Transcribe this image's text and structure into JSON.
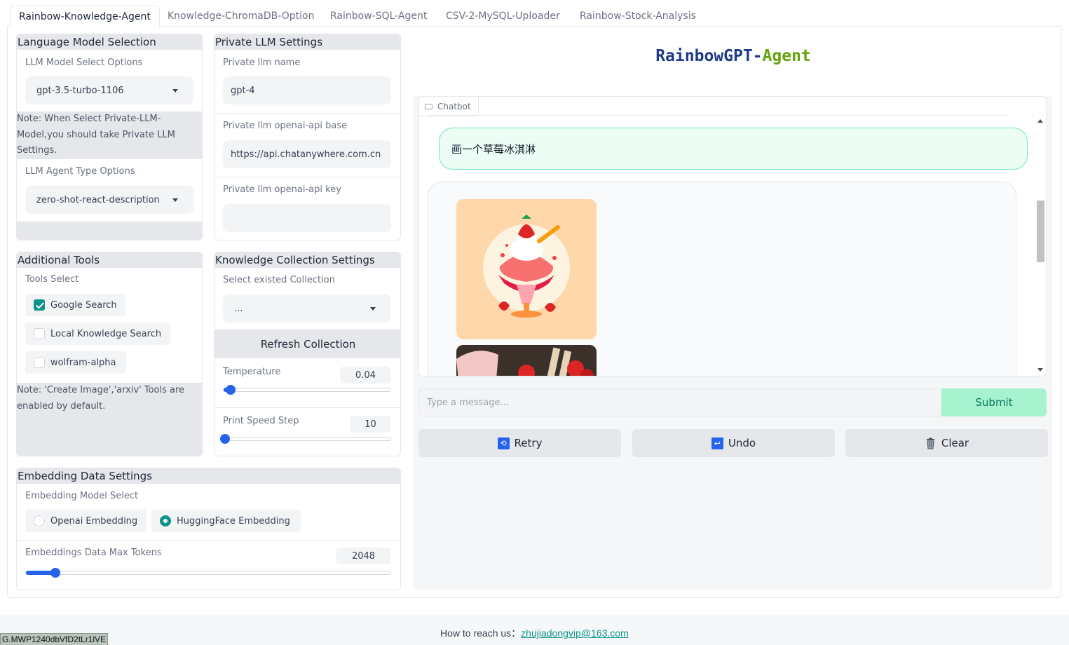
{
  "tabs": [
    {
      "label": "Rainbow-Knowledge-Agent",
      "active": true
    },
    {
      "label": "Knowledge-ChromaDB-Option"
    },
    {
      "label": "Rainbow-SQL-Agent"
    },
    {
      "label": "CSV-2-MySQL-Uploader"
    },
    {
      "label": "Rainbow-Stock-Analysis"
    }
  ],
  "llm_selection": {
    "title": "Language Model Selection",
    "model_label": "LLM Model Select Options",
    "model_value": "gpt-3.5-turbo-1106",
    "note": "Note: When Select Private-LLM-Model,you should take Private LLM Settings.",
    "agent_label": "LLM Agent Type Options",
    "agent_value": "zero-shot-react-description"
  },
  "private_llm": {
    "title": "Private LLM Settings",
    "name_label": "Private llm name",
    "name_value": "gpt-4",
    "base_label": "Private llm openai-api base",
    "base_value": "https://api.chatanywhere.com.cn",
    "key_label": "Private llm openai-api key",
    "key_value": ""
  },
  "tools": {
    "title": "Additional Tools",
    "label": "Tools Select",
    "options": [
      {
        "label": "Google Search",
        "checked": true
      },
      {
        "label": "Local Knowledge Search",
        "checked": false
      },
      {
        "label": "wolfram-alpha",
        "checked": false
      }
    ],
    "note": "Note: 'Create Image','arxiv' Tools are enabled by default."
  },
  "knowledge": {
    "title": "Knowledge Collection Settings",
    "collection_label": "Select existed Collection",
    "collection_value": "...",
    "refresh_label": "Refresh Collection",
    "temperature_label": "Temperature",
    "temperature_value": "0.04",
    "temperature_fraction": 0.04,
    "speed_label": "Print Speed Step",
    "speed_value": "10",
    "speed_fraction": 0.0
  },
  "embedding": {
    "title": "Embedding Data Settings",
    "model_label": "Embedding Model Select",
    "options": [
      {
        "label": "Openai Embedding",
        "selected": false
      },
      {
        "label": "HuggingFace Embedding",
        "selected": true
      }
    ],
    "tokens_label": "Embeddings Data Max Tokens",
    "tokens_value": "2048",
    "tokens_fraction": 0.08
  },
  "app_title_part1": "RainbowGPT-",
  "app_title_part2": "Agent",
  "chatbot": {
    "label": "Chatbot",
    "user_message": "画一个草莓冰淇淋",
    "input_placeholder": "Type a message...",
    "submit_label": "Submit",
    "retry_label": "Retry",
    "undo_label": "Undo",
    "clear_label": "Clear"
  },
  "footer": {
    "text": "How to reach us：",
    "email": "zhujiadongvip@163.com",
    "status_chip": "G.MWP1240dbVfD2tLr1lVE"
  },
  "colors": {
    "accent": "#0d9488",
    "slider": "#2563eb",
    "submit_bg": "#a7f3d0",
    "title_blue": "#1e3a8a",
    "title_green": "#65a30d"
  }
}
